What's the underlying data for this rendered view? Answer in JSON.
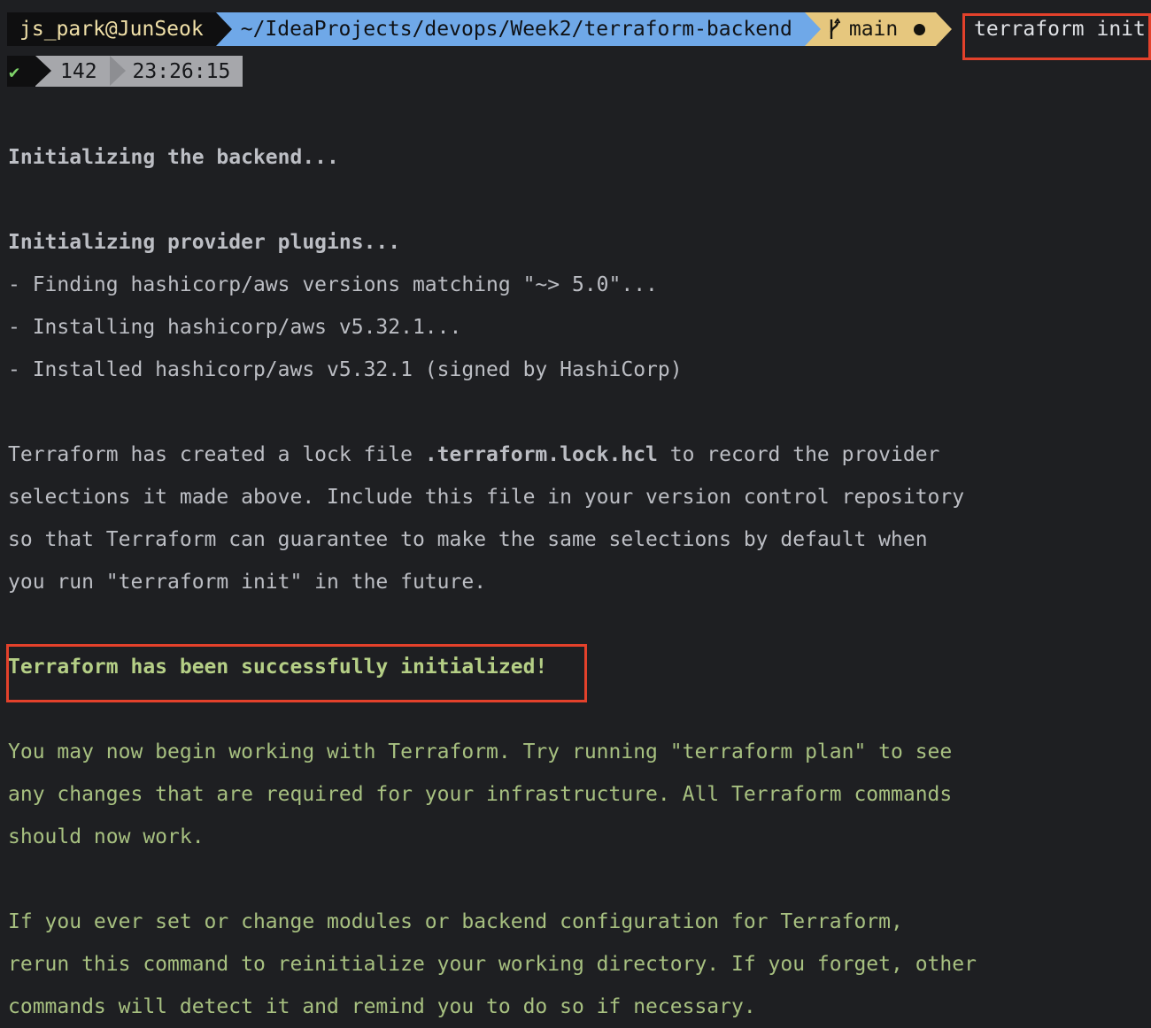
{
  "prompt": {
    "user": "js_park@JunSeok",
    "path": "~/IdeaProjects/devops/Week2/terraform-backend",
    "branch": "main",
    "branch_icon": "git-branch-icon",
    "dirty_icon": "dirty-dot-icon",
    "command": "terraform init"
  },
  "status": {
    "ok_icon": "✔",
    "count": "142",
    "time": "23:26:15"
  },
  "output": {
    "backend": "Initializing the backend...",
    "plugins": "Initializing provider plugins...",
    "finding": "- Finding hashicorp/aws versions matching \"~> 5.0\"...",
    "installing": "- Installing hashicorp/aws v5.32.1...",
    "installed": "- Installed hashicorp/aws v5.32.1 (signed by HashiCorp)",
    "lock_1_pre": "Terraform has created a lock file ",
    "lock_1_file": ".terraform.lock.hcl",
    "lock_1_post": " to record the provider",
    "lock_2": "selections it made above. Include this file in your version control repository",
    "lock_3": "so that Terraform can guarantee to make the same selections by default when",
    "lock_4": "you run \"terraform init\" in the future.",
    "success": "Terraform has been successfully initialized!",
    "begin_1": "You may now begin working with Terraform. Try running \"terraform plan\" to see",
    "begin_2": "any changes that are required for your infrastructure. All Terraform commands",
    "begin_3": "should now work.",
    "rerun_1": "If you ever set or change modules or backend configuration for Terraform,",
    "rerun_2": "rerun this command to reinitialize your working directory. If you forget, other",
    "rerun_3": "commands will detect it and remind you to do so if necessary."
  },
  "colors": {
    "background": "#1e1f22",
    "text": "#bcbec4",
    "success_green": "#a7c080",
    "highlight_red": "#e3412b",
    "path_blue": "#6fa8e8",
    "git_yellow": "#e6c77e"
  }
}
